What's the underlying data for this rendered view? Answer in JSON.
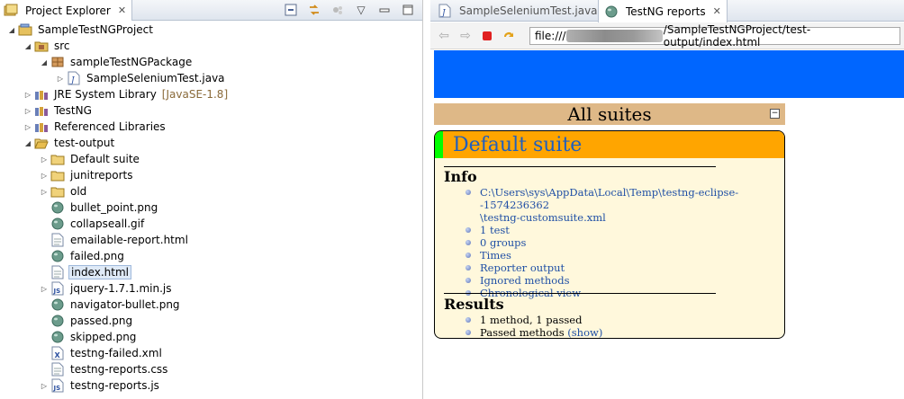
{
  "left_panel": {
    "tab_title": "Project Explorer",
    "tree": [
      {
        "label": "SampleTestNGProject",
        "indent": 0,
        "twisty": "open",
        "icon": "project-icon"
      },
      {
        "label": "src",
        "indent": 1,
        "twisty": "open",
        "icon": "source-folder-icon"
      },
      {
        "label": "sampleTestNGPackage",
        "indent": 2,
        "twisty": "open",
        "icon": "package-icon"
      },
      {
        "label": "SampleSeleniumTest.java",
        "indent": 3,
        "twisty": "closed",
        "icon": "java-file-icon"
      },
      {
        "label": "JRE System Library",
        "deco": "[JavaSE-1.8]",
        "indent": 1,
        "twisty": "closed",
        "icon": "library-icon"
      },
      {
        "label": "TestNG",
        "indent": 1,
        "twisty": "closed",
        "icon": "library-icon"
      },
      {
        "label": "Referenced Libraries",
        "indent": 1,
        "twisty": "closed",
        "icon": "library-icon"
      },
      {
        "label": "test-output",
        "indent": 1,
        "twisty": "open",
        "icon": "folder-open-icon"
      },
      {
        "label": "Default suite",
        "indent": 2,
        "twisty": "closed",
        "icon": "folder-icon"
      },
      {
        "label": "junitreports",
        "indent": 2,
        "twisty": "closed",
        "icon": "folder-icon"
      },
      {
        "label": "old",
        "indent": 2,
        "twisty": "closed",
        "icon": "folder-icon"
      },
      {
        "label": "bullet_point.png",
        "indent": 2,
        "twisty": "none",
        "icon": "image-file-icon"
      },
      {
        "label": "collapseall.gif",
        "indent": 2,
        "twisty": "none",
        "icon": "image-file-icon"
      },
      {
        "label": "emailable-report.html",
        "indent": 2,
        "twisty": "none",
        "icon": "text-file-icon"
      },
      {
        "label": "failed.png",
        "indent": 2,
        "twisty": "none",
        "icon": "image-file-icon"
      },
      {
        "label": "index.html",
        "indent": 2,
        "twisty": "none",
        "icon": "text-file-icon",
        "selected": true
      },
      {
        "label": "jquery-1.7.1.min.js",
        "indent": 2,
        "twisty": "closed",
        "icon": "js-file-icon"
      },
      {
        "label": "navigator-bullet.png",
        "indent": 2,
        "twisty": "none",
        "icon": "image-file-icon"
      },
      {
        "label": "passed.png",
        "indent": 2,
        "twisty": "none",
        "icon": "image-file-icon"
      },
      {
        "label": "skipped.png",
        "indent": 2,
        "twisty": "none",
        "icon": "image-file-icon"
      },
      {
        "label": "testng-failed.xml",
        "indent": 2,
        "twisty": "none",
        "icon": "xml-file-icon"
      },
      {
        "label": "testng-reports.css",
        "indent": 2,
        "twisty": "none",
        "icon": "text-file-icon"
      },
      {
        "label": "testng-reports.js",
        "indent": 2,
        "twisty": "closed",
        "icon": "js-file-icon"
      }
    ]
  },
  "right_panel": {
    "tabs": [
      {
        "label": "SampleSeleniumTest.java",
        "icon": "java-file-icon",
        "active": false
      },
      {
        "label": "TestNG reports",
        "icon": "globe-icon",
        "active": true
      }
    ],
    "url_prefix": "file:///",
    "url_suffix": "/SampleTestNGProject/test-output/index.html",
    "report": {
      "all_suites": "All suites",
      "collapse_glyph": "−",
      "suite_title": "Default suite",
      "info_title": "Info",
      "info_items": [
        "C:\\Users\\sys\\AppData\\Local\\Temp\\testng-eclipse--1574236362",
        "\\testng-customsuite.xml",
        "1 test",
        "0 groups",
        "Times",
        "Reporter output",
        "Ignored methods",
        "Chronological view"
      ],
      "results_title": "Results",
      "results_items": [
        "1 method, 1 passed"
      ],
      "passed_methods_label": "Passed methods",
      "show_link": "(show)"
    }
  },
  "colors": {
    "banner": "#0066ff",
    "all_suites_bg": "#deb887",
    "suite_header": "#ffa500",
    "suite_stripe": "#00ff00",
    "suite_body": "#fff8dc",
    "link": "#1f4fa5"
  }
}
